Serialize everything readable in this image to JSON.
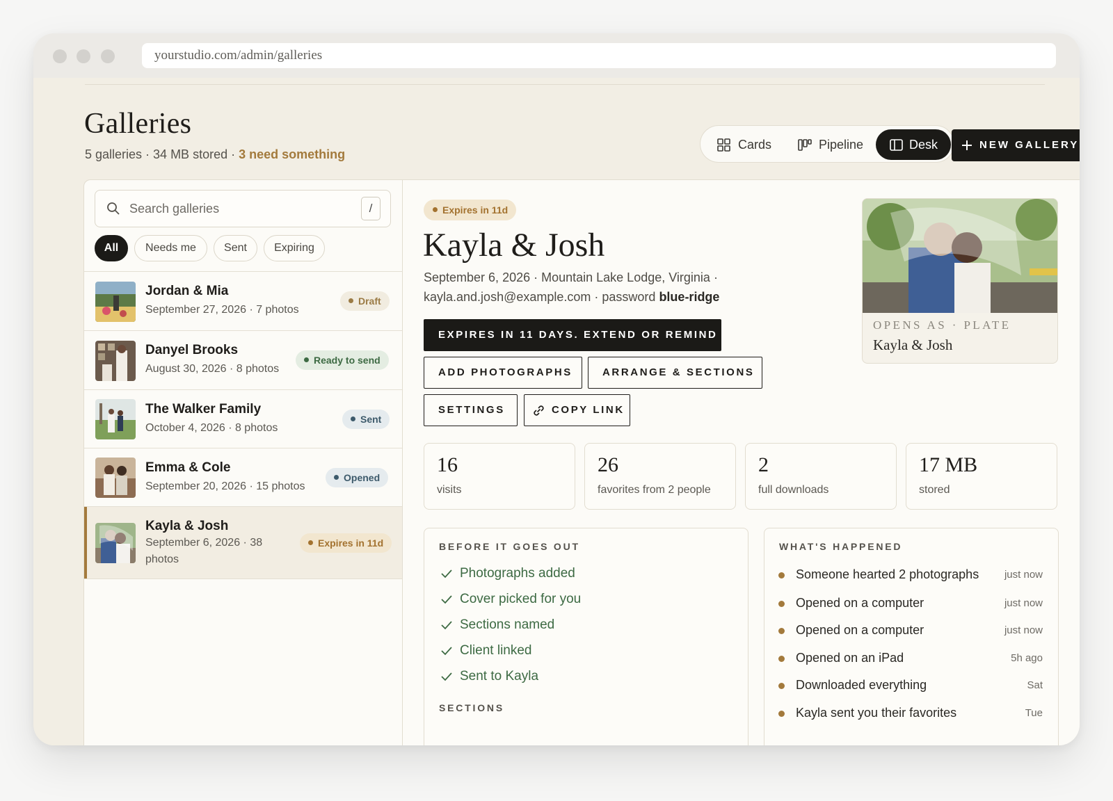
{
  "browser": {
    "url": "yourstudio.com/admin/galleries"
  },
  "header": {
    "title": "Galleries",
    "subtitle_stats": "5 galleries · 34 MB stored · ",
    "subtitle_alert": "3 need something",
    "views": [
      "Cards",
      "Pipeline",
      "Desk"
    ],
    "active_view": "Desk",
    "new_button": "NEW GALLERY"
  },
  "sidebar": {
    "search_placeholder": "Search galleries",
    "search_shortcut": "/",
    "filters": [
      "All",
      "Needs me",
      "Sent",
      "Expiring"
    ],
    "active_filter": "All",
    "galleries": [
      {
        "name": "Jordan & Mia",
        "meta": "September 27, 2026 · 7 photos",
        "status": "Draft"
      },
      {
        "name": "Danyel Brooks",
        "meta": "August 30, 2026 · 8 photos",
        "status": "Ready to send"
      },
      {
        "name": "The Walker Family",
        "meta": "October 4, 2026 · 8 photos",
        "status": "Sent"
      },
      {
        "name": "Emma & Cole",
        "meta": "September 20, 2026 · 15 photos",
        "status": "Opened"
      },
      {
        "name": "Kayla & Josh",
        "meta": "September 6, 2026 · 38 photos",
        "status": "Expires in 11d"
      }
    ],
    "selected": "Kayla & Josh"
  },
  "detail": {
    "badge": "Expires in 11d",
    "name": "Kayla & Josh",
    "meta_line1": "September 6, 2026 · Mountain Lake Lodge, Virginia ·",
    "meta_email": "kayla.and.josh@example.com · password ",
    "password": "blue-ridge",
    "primary_action": "EXPIRES IN 11 DAYS. EXTEND OR REMIND",
    "actions": [
      "ADD PHOTOGRAPHS",
      "ARRANGE & SECTIONS",
      "SETTINGS",
      "COPY LINK"
    ],
    "cover": {
      "caption": "OPENS AS · PLATE",
      "title": "Kayla & Josh"
    },
    "stats": [
      {
        "value": "16",
        "label": "visits"
      },
      {
        "value": "26",
        "label": "favorites from 2 people"
      },
      {
        "value": "2",
        "label": "full downloads"
      },
      {
        "value": "17 MB",
        "label": "stored"
      }
    ],
    "checklist_title": "BEFORE IT GOES OUT",
    "checklist": [
      "Photographs added",
      "Cover picked for you",
      "Sections named",
      "Client linked",
      "Sent to Kayla"
    ],
    "sections_title": "SECTIONS",
    "activity_title": "WHAT'S HAPPENED",
    "activity": [
      {
        "text": "Someone hearted 2 photographs",
        "when": "just now"
      },
      {
        "text": "Opened on a computer",
        "when": "just now"
      },
      {
        "text": "Opened on a computer",
        "when": "just now"
      },
      {
        "text": "Opened on an iPad",
        "when": "5h ago"
      },
      {
        "text": "Downloaded everything",
        "when": "Sat"
      },
      {
        "text": "Kayla sent you their favorites",
        "when": "Tue"
      }
    ]
  },
  "colors": {
    "accent": "#a37a3c",
    "ink": "#1b1a17",
    "paper": "#f2eee4",
    "success": "#3d6a43"
  }
}
